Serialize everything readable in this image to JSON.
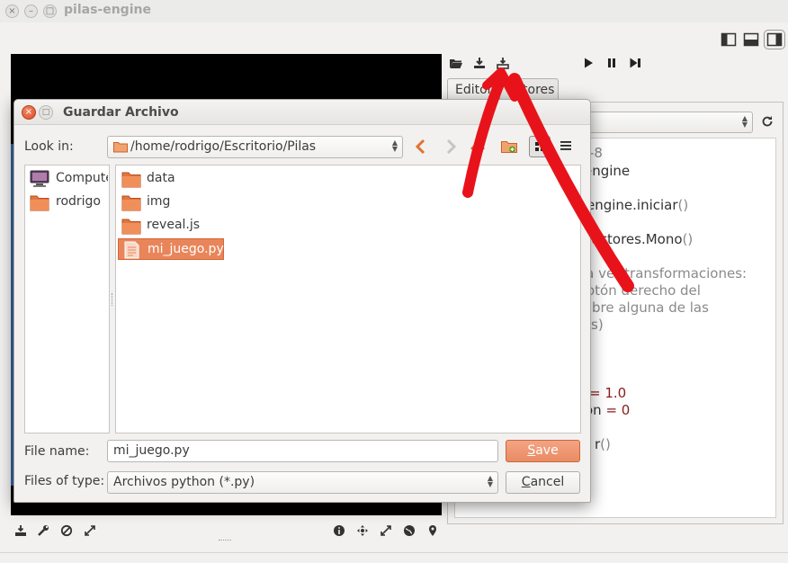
{
  "window": {
    "title": "pilas-engine",
    "close_glyph": "×",
    "min_glyph": "–",
    "max_glyph": "□"
  },
  "layout_buttons": [
    "layout-left-icon",
    "layout-bottom-icon",
    "layout-right-icon"
  ],
  "right_pane": {
    "toolbar_icons": [
      "open-folder-icon",
      "save-icon",
      "save-as-icon",
      "play-icon",
      "pause-icon",
      "step-icon"
    ],
    "tabs": [
      {
        "label": "Editor",
        "active": true
      },
      {
        "label": "Actores",
        "active": false
      }
    ],
    "code_lines": [
      {
        "parts": [
          {
            "t": "-8",
            "c": "p"
          }
        ]
      },
      {
        "parts": [
          {
            "t": "engine",
            "c": "kw"
          }
        ]
      },
      {
        "parts": [
          {
            "t": "engine.iniciar",
            "c": "kw"
          },
          {
            "t": "()",
            "c": "p"
          }
        ]
      },
      {
        "parts": [
          {
            "t": "s.actores.Mono",
            "c": "kw"
          },
          {
            "t": "()",
            "c": "p"
          }
        ]
      },
      {
        "parts": [
          {
            "t": "ra ver transformaciones:",
            "c": "cm"
          }
        ]
      },
      {
        "parts": [
          {
            "t": "otón derecho del",
            "c": "cm"
          }
        ]
      },
      {
        "parts": [
          {
            "t": "bre alguna de las",
            "c": "cm"
          }
        ]
      },
      {
        "parts": [
          {
            "t": "s)",
            "c": "cm"
          }
        ]
      },
      {
        "parts": [
          {
            "t": " = ",
            "c": "num"
          },
          {
            "t": "1.0",
            "c": "num"
          }
        ]
      },
      {
        "parts": [
          {
            "t": "on",
            "c": "kw"
          },
          {
            "t": " = ",
            "c": "num"
          },
          {
            "t": "0",
            "c": "num"
          }
        ]
      },
      {
        "parts": [
          {
            "t": "r",
            "c": "kw"
          },
          {
            "t": "()",
            "c": "p"
          }
        ]
      }
    ]
  },
  "bottom_toolbar_icons": [
    "save-icon",
    "wrench-icon",
    "no-entry-icon",
    "fullscreen-icon",
    "info-icon",
    "move-icon",
    "expand-icon",
    "globe-icon",
    "pin-icon"
  ],
  "dialog": {
    "title": "Guardar Archivo",
    "look_in_label": "Look in:",
    "path": "/home/rodrigo/Escritorio/Pilas",
    "places": [
      {
        "label": "Computer",
        "icon": "computer-icon"
      },
      {
        "label": "rodrigo",
        "icon": "home-folder-icon"
      }
    ],
    "files": [
      {
        "name": "data",
        "type": "folder",
        "selected": false
      },
      {
        "name": "img",
        "type": "folder",
        "selected": false
      },
      {
        "name": "reveal.js",
        "type": "folder",
        "selected": false
      },
      {
        "name": "mi_juego.py",
        "type": "file",
        "selected": true
      }
    ],
    "file_name_label": "File name:",
    "file_name_value": "mi_juego.py",
    "files_of_type_label": "Files of type:",
    "files_of_type_value": "Archivos python (*.py)",
    "save_label": "Save",
    "save_mnemonic": "S",
    "save_rest": "ave",
    "cancel_label": "Cancel",
    "cancel_mnemonic": "C",
    "cancel_rest": "ancel"
  },
  "annotation_color": "#e8131a"
}
